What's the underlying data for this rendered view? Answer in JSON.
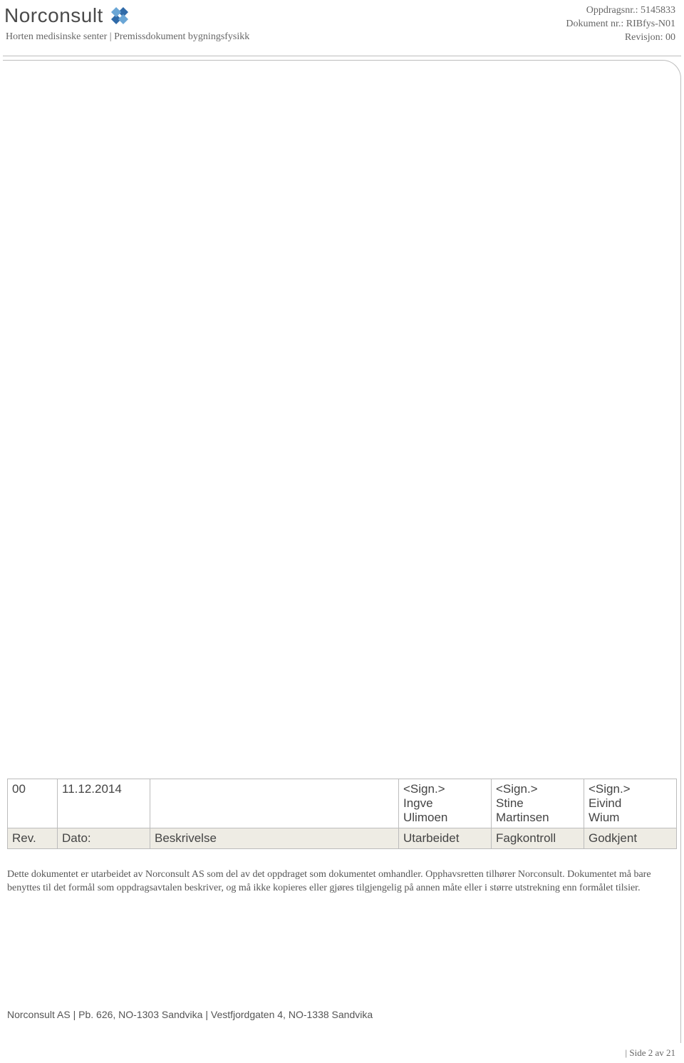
{
  "header": {
    "logo_text": "Norconsult",
    "subtitle": "Horten medisinske senter | Premissdokument bygningsfysikk",
    "meta": {
      "oppdrag_label": "Oppdragsnr.:",
      "oppdrag_value": "5145833",
      "dokument_label": "Dokument nr.:",
      "dokument_value": "RIBfys-N01",
      "revisjon_label": "Revisjon:",
      "revisjon_value": "00"
    }
  },
  "revision_table": {
    "row": {
      "rev": "00",
      "date": "11.12.2014",
      "desc": "",
      "utarbeidet": "<Sign.>\nIngve\nUlimoen",
      "fagkontroll": "<Sign.>\nStine\nMartinsen",
      "godkjent": "<Sign.>\nEivind\nWium"
    },
    "headers": {
      "rev": "Rev.",
      "date": "Dato:",
      "desc": "Beskrivelse",
      "utarbeidet": "Utarbeidet",
      "fagkontroll": "Fagkontroll",
      "godkjent": "Godkjent"
    }
  },
  "disclaimer": "Dette dokumentet er utarbeidet av Norconsult AS som del av det oppdraget som dokumentet omhandler. Opphavsretten tilhører Norconsult. Dokumentet må bare benyttes til det formål som oppdragsavtalen beskriver, og må ikke kopieres eller gjøres tilgjengelig på annen måte eller i større utstrekning enn formålet tilsier.",
  "footer": {
    "company_line": "Norconsult AS | Pb. 626, NO-1303 Sandvika | Vestfjordgaten 4, NO-1338 Sandvika",
    "page": "| Side 2 av 21"
  }
}
